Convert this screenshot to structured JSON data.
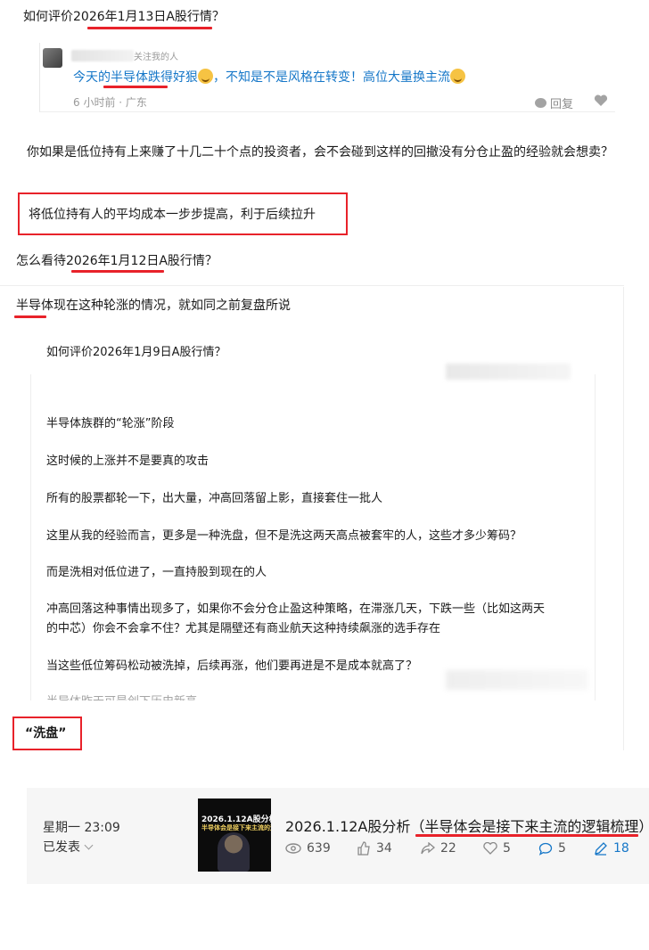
{
  "section1": {
    "title": "如何评价2026年1月13日A股行情？",
    "comment": {
      "follow_tag": "关注我的人",
      "reply_text_before": "今天的",
      "reply_text_highlight": "半导体跌",
      "reply_text_mid": "得好狠",
      "reply_text_after": "，不知是不是风格在转变！高位大量换主流",
      "meta": "6 小时前 · 广东",
      "reply_label": "回复"
    },
    "paragraph": "你如果是低位持有上来赚了十几二十个点的投资者，会不会碰到这样的回撤没有分仓止盈的经验就会想卖？",
    "highlight": "将低位持有人的平均成本一步步提高，利于后续拉升"
  },
  "section2": {
    "title": "怎么看待2026年1月12日A股行情？",
    "lead": "半导体现在这种轮涨的情况，就如同之前复盘所说",
    "quote_title": "如何评价2026年1月9日A股行情？",
    "quote_lines": [
      "半导体族群的“轮涨”阶段",
      "这时候的上涨并不是要真的攻击",
      "所有的股票都轮一下，出大量，冲高回落留上影，直接套住一批人",
      "这里从我的经验而言，更多是一种洗盘，但不是洗这两天高点被套牢的人，这些才多少筹码？",
      "而是洗相对低位进了，一直持股到现在的人",
      "冲高回落这种事情出现多了，如果你不会分仓止盈这种策略，在滞涨几天，下跌一些（比如这两天",
      "的中芯）你会不会拿不住？尤其是隔壁还有商业航天这种持续飙涨的选手存在",
      "当这些低位筹码松动被洗掉，后续再涨，他们要再进是不是成本就高了？",
      "半导体昨天可是创下历史新高"
    ],
    "boxed_word": "“洗盘”"
  },
  "section3": {
    "date": "星期一 23:09",
    "status": "已发表",
    "thumb_line1": "2026.1.12A股分析",
    "thumb_line2": "半导体会是接下来主流的逻辑",
    "title_prefix": "2026.1.12A股分析（",
    "title_highlight": "半导体会是接下来主流的逻辑梳理",
    "title_suffix": "）",
    "stats": {
      "views": "639",
      "likes": "34",
      "shares": "22",
      "favorites": "5",
      "comments": "5",
      "edits": "18"
    }
  },
  "colors": {
    "annotation_red": "#e8222a",
    "link_blue": "#1677c8",
    "meta_gray": "#9a9a9a"
  }
}
